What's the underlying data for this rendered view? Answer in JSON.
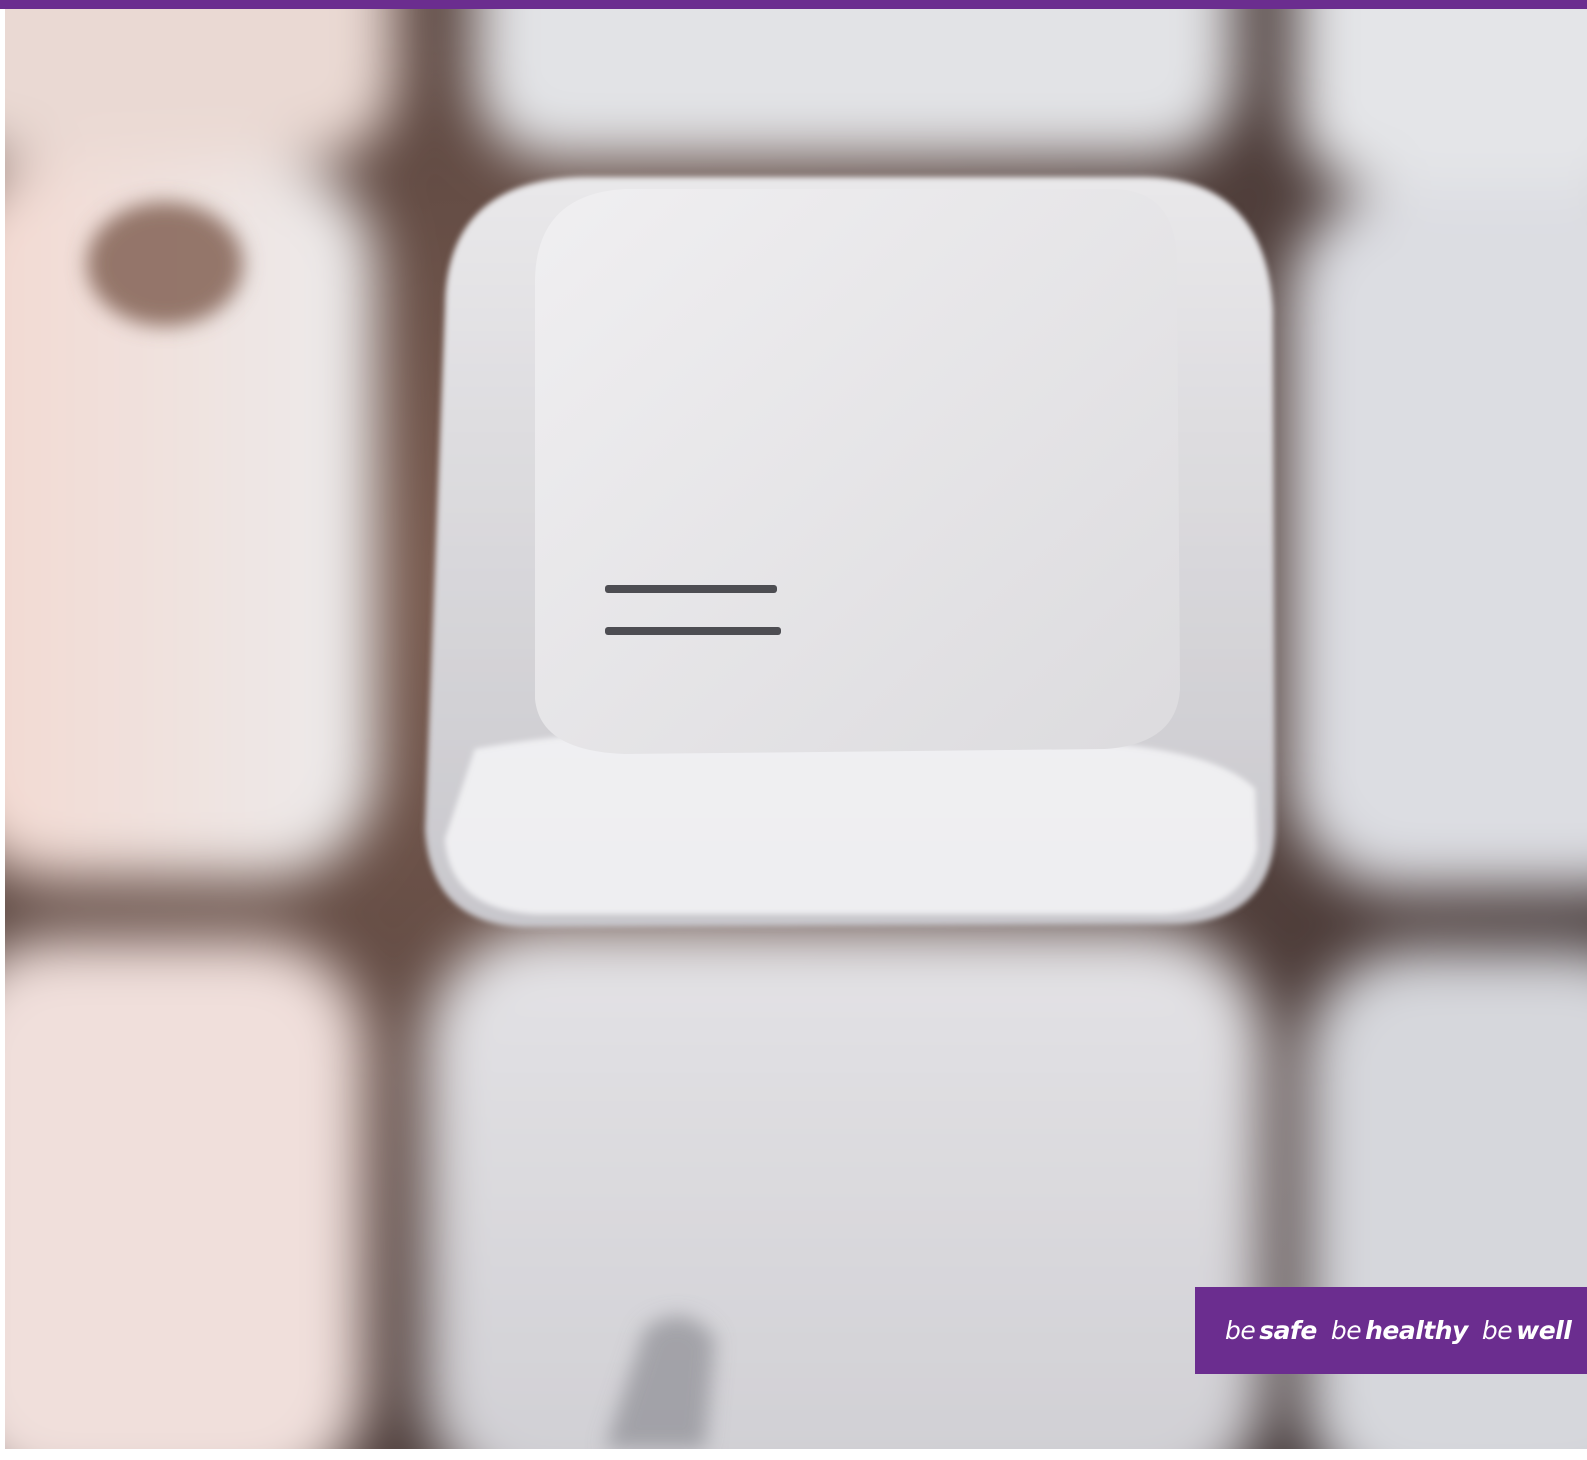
{
  "colors": {
    "brand_purple": "#6b2d8f",
    "key_white": "#e6e4e6",
    "gap_dark": "#4a3a36"
  },
  "photo": {
    "subject": "keyboard-keys-closeup",
    "focused_key_symbol": "="
  },
  "tagline": {
    "part1_prefix": "be",
    "part1_word": "safe",
    "part2_prefix": "be",
    "part2_word": "healthy",
    "part3_prefix": "be",
    "part3_word": "well"
  }
}
